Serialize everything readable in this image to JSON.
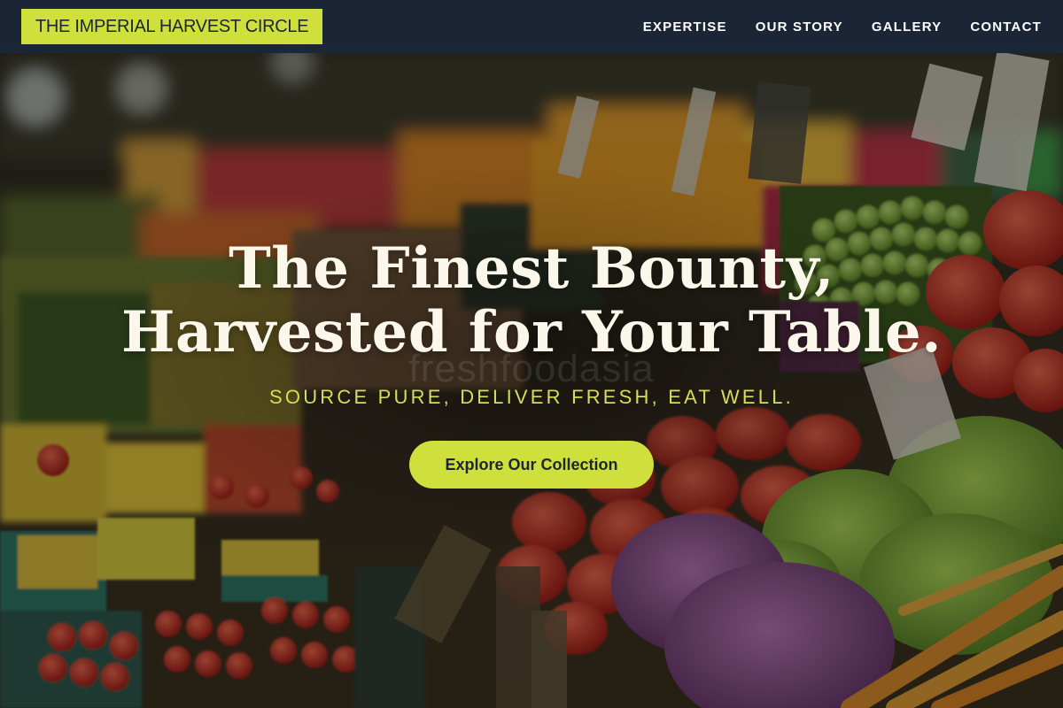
{
  "navbar": {
    "brand": "THE IMPERIAL HARVEST CIRCLE",
    "links": [
      "EXPERTISE",
      "OUR STORY",
      "GALLERY",
      "CONTACT"
    ]
  },
  "hero": {
    "title_line1": "The Finest Bounty,",
    "title_line2": "Harvested for Your Table.",
    "tagline": "SOURCE PURE, DELIVER FRESH, EAT WELL.",
    "cta_label": "Explore Our Collection",
    "watermark": "freshfoodasia"
  },
  "colors": {
    "accent": "#cfe03c",
    "navbar_bg": "#1b2638",
    "title": "#fbf7ea",
    "tagline": "#d8dc57"
  }
}
